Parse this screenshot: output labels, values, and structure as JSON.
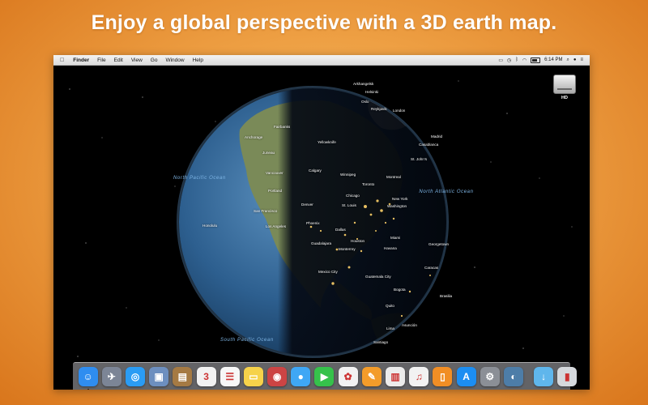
{
  "headline": "Enjoy a global perspective with a 3D earth map.",
  "menubar": {
    "apple_icon": "apple-icon",
    "app_name": "Finder",
    "menus": [
      "File",
      "Edit",
      "View",
      "Go",
      "Window",
      "Help"
    ],
    "clock": "6:14 PM",
    "status_icons": [
      "airplay-icon",
      "time-machine-icon",
      "bluetooth-icon",
      "wifi-icon",
      "battery-icon",
      "search-icon",
      "user-icon",
      "list-icon"
    ]
  },
  "desktop": {
    "hd_label": "HD"
  },
  "map": {
    "oceans": [
      "North Pacific Ocean",
      "North Atlantic Ocean",
      "South Pacific Ocean"
    ],
    "cities": [
      {
        "name": "Arkhangelsk"
      },
      {
        "name": "Helsinki"
      },
      {
        "name": "Oslo"
      },
      {
        "name": "Reykjavik"
      },
      {
        "name": "London"
      },
      {
        "name": "Madrid"
      },
      {
        "name": "Casablanca"
      },
      {
        "name": "St. John's"
      },
      {
        "name": "Fairbanks"
      },
      {
        "name": "Anchorage"
      },
      {
        "name": "Yellowknife"
      },
      {
        "name": "Juneau"
      },
      {
        "name": "Vancouver"
      },
      {
        "name": "Calgary"
      },
      {
        "name": "Winnipeg"
      },
      {
        "name": "Montreal"
      },
      {
        "name": "Toronto"
      },
      {
        "name": "Portland"
      },
      {
        "name": "Chicago"
      },
      {
        "name": "New York"
      },
      {
        "name": "Washington"
      },
      {
        "name": "Denver"
      },
      {
        "name": "St. Louis"
      },
      {
        "name": "San Francisco"
      },
      {
        "name": "Los Angeles"
      },
      {
        "name": "Phoenix"
      },
      {
        "name": "Honolulu"
      },
      {
        "name": "Dallas"
      },
      {
        "name": "Houston"
      },
      {
        "name": "Miami"
      },
      {
        "name": "Monterrey"
      },
      {
        "name": "Havana"
      },
      {
        "name": "Guadalajara"
      },
      {
        "name": "Mexico City"
      },
      {
        "name": "Guatemala City"
      },
      {
        "name": "Caracas"
      },
      {
        "name": "Georgetown"
      },
      {
        "name": "Bogota"
      },
      {
        "name": "Quito"
      },
      {
        "name": "Lima"
      },
      {
        "name": "Brasilia"
      },
      {
        "name": "Asunción"
      },
      {
        "name": "Santiago"
      }
    ]
  },
  "dock": {
    "apps": [
      {
        "name": "Finder",
        "icon": "finder-icon",
        "color": "#2f8df0",
        "glyph": "☺"
      },
      {
        "name": "Launchpad",
        "icon": "launchpad-icon",
        "color": "#7c8596",
        "glyph": "✈"
      },
      {
        "name": "Safari",
        "icon": "safari-icon",
        "color": "#2a9cf4",
        "glyph": "◎"
      },
      {
        "name": "Preview",
        "icon": "preview-icon",
        "color": "#6d8fbf",
        "glyph": "▣"
      },
      {
        "name": "Contacts",
        "icon": "contacts-icon",
        "color": "#a57a43",
        "glyph": "▤"
      },
      {
        "name": "Calendar",
        "icon": "calendar-icon",
        "color": "#f2f2f2",
        "glyph": "3"
      },
      {
        "name": "Reminders",
        "icon": "reminders-icon",
        "color": "#f7f7f7",
        "glyph": "☰"
      },
      {
        "name": "Notes",
        "icon": "notes-icon",
        "color": "#f6d24a",
        "glyph": "▭"
      },
      {
        "name": "Photo Booth",
        "icon": "photo-booth-icon",
        "color": "#c44",
        "glyph": "◉"
      },
      {
        "name": "Messages",
        "icon": "messages-icon",
        "color": "#3fa7f5",
        "glyph": "●"
      },
      {
        "name": "FaceTime",
        "icon": "facetime-icon",
        "color": "#36c24b",
        "glyph": "▶"
      },
      {
        "name": "Photos",
        "icon": "photos-icon",
        "color": "#f2f2f2",
        "glyph": "✿"
      },
      {
        "name": "Pages",
        "icon": "pages-icon",
        "color": "#f39c2a",
        "glyph": "✎"
      },
      {
        "name": "Numbers",
        "icon": "numbers-icon",
        "color": "#ececec",
        "glyph": "▥"
      },
      {
        "name": "iTunes",
        "icon": "itunes-icon",
        "color": "#f2f2f2",
        "glyph": "♫"
      },
      {
        "name": "iBooks",
        "icon": "ibooks-icon",
        "color": "#f18e25",
        "glyph": "▯"
      },
      {
        "name": "App Store",
        "icon": "app-store-icon",
        "color": "#1c8ef2",
        "glyph": "A"
      },
      {
        "name": "System Preferences",
        "icon": "system-preferences-icon",
        "color": "#8b8f96",
        "glyph": "⚙"
      },
      {
        "name": "Earth Map",
        "icon": "earth-map-icon",
        "color": "#4d7da8",
        "glyph": "◐"
      }
    ],
    "right_items": [
      {
        "name": "Downloads",
        "icon": "downloads-folder-icon",
        "color": "#5fb6ec",
        "glyph": "↓"
      },
      {
        "name": "Trash",
        "icon": "trash-icon",
        "color": "#d6d9dd",
        "glyph": "▮"
      }
    ]
  }
}
